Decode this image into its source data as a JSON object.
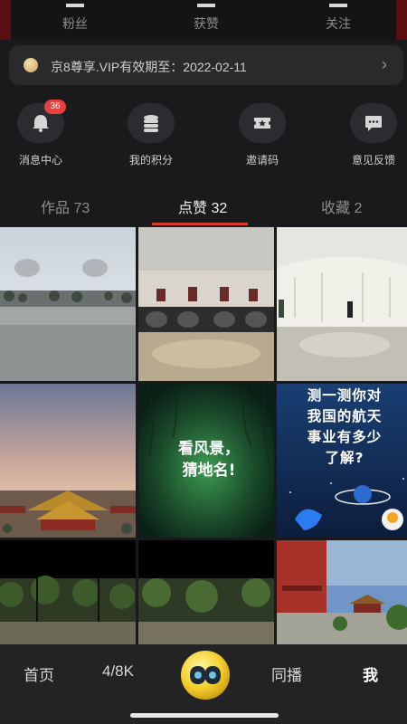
{
  "stats": [
    {
      "label": "粉丝"
    },
    {
      "label": "获赞"
    },
    {
      "label": "关注"
    }
  ],
  "vip": {
    "text": "京8尊享.VIP有效期至：2022-02-11",
    "chevron": "›"
  },
  "shortcuts": [
    {
      "label": "消息中心",
      "icon": "message-bell-icon",
      "badge": "36"
    },
    {
      "label": "我的积分",
      "icon": "coins-stack-icon"
    },
    {
      "label": "邀请码",
      "icon": "ticket-star-icon"
    },
    {
      "label": "意见反馈",
      "icon": "feedback-chat-icon"
    }
  ],
  "tabs": [
    {
      "label": "作品 73"
    },
    {
      "label": "点赞 32",
      "active": true
    },
    {
      "label": "收藏 2"
    }
  ],
  "grid_text": {
    "cell5": "看风景，\n猜地名!",
    "cell6_line1": "测一测你对",
    "cell6_line2": "我国的航天",
    "cell6_line3": "事业有多少",
    "cell6_line4": "了解?"
  },
  "nav": {
    "home": "首页",
    "vr": "4/8K",
    "broadcast": "同播",
    "me": "我"
  },
  "colors": {
    "accent": "#d63b2f",
    "badge": "#e7413d"
  }
}
